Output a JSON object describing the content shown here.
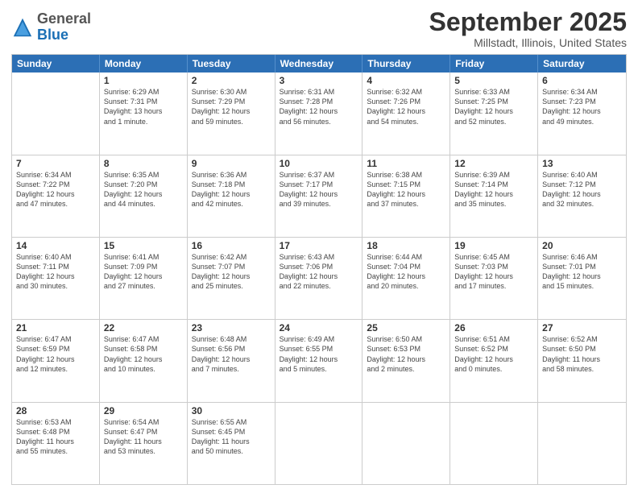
{
  "logo": {
    "general": "General",
    "blue": "Blue"
  },
  "title": "September 2025",
  "location": "Millstadt, Illinois, United States",
  "weekdays": [
    "Sunday",
    "Monday",
    "Tuesday",
    "Wednesday",
    "Thursday",
    "Friday",
    "Saturday"
  ],
  "rows": [
    [
      {
        "day": "",
        "info": ""
      },
      {
        "day": "1",
        "info": "Sunrise: 6:29 AM\nSunset: 7:31 PM\nDaylight: 13 hours\nand 1 minute."
      },
      {
        "day": "2",
        "info": "Sunrise: 6:30 AM\nSunset: 7:29 PM\nDaylight: 12 hours\nand 59 minutes."
      },
      {
        "day": "3",
        "info": "Sunrise: 6:31 AM\nSunset: 7:28 PM\nDaylight: 12 hours\nand 56 minutes."
      },
      {
        "day": "4",
        "info": "Sunrise: 6:32 AM\nSunset: 7:26 PM\nDaylight: 12 hours\nand 54 minutes."
      },
      {
        "day": "5",
        "info": "Sunrise: 6:33 AM\nSunset: 7:25 PM\nDaylight: 12 hours\nand 52 minutes."
      },
      {
        "day": "6",
        "info": "Sunrise: 6:34 AM\nSunset: 7:23 PM\nDaylight: 12 hours\nand 49 minutes."
      }
    ],
    [
      {
        "day": "7",
        "info": "Sunrise: 6:34 AM\nSunset: 7:22 PM\nDaylight: 12 hours\nand 47 minutes."
      },
      {
        "day": "8",
        "info": "Sunrise: 6:35 AM\nSunset: 7:20 PM\nDaylight: 12 hours\nand 44 minutes."
      },
      {
        "day": "9",
        "info": "Sunrise: 6:36 AM\nSunset: 7:18 PM\nDaylight: 12 hours\nand 42 minutes."
      },
      {
        "day": "10",
        "info": "Sunrise: 6:37 AM\nSunset: 7:17 PM\nDaylight: 12 hours\nand 39 minutes."
      },
      {
        "day": "11",
        "info": "Sunrise: 6:38 AM\nSunset: 7:15 PM\nDaylight: 12 hours\nand 37 minutes."
      },
      {
        "day": "12",
        "info": "Sunrise: 6:39 AM\nSunset: 7:14 PM\nDaylight: 12 hours\nand 35 minutes."
      },
      {
        "day": "13",
        "info": "Sunrise: 6:40 AM\nSunset: 7:12 PM\nDaylight: 12 hours\nand 32 minutes."
      }
    ],
    [
      {
        "day": "14",
        "info": "Sunrise: 6:40 AM\nSunset: 7:11 PM\nDaylight: 12 hours\nand 30 minutes."
      },
      {
        "day": "15",
        "info": "Sunrise: 6:41 AM\nSunset: 7:09 PM\nDaylight: 12 hours\nand 27 minutes."
      },
      {
        "day": "16",
        "info": "Sunrise: 6:42 AM\nSunset: 7:07 PM\nDaylight: 12 hours\nand 25 minutes."
      },
      {
        "day": "17",
        "info": "Sunrise: 6:43 AM\nSunset: 7:06 PM\nDaylight: 12 hours\nand 22 minutes."
      },
      {
        "day": "18",
        "info": "Sunrise: 6:44 AM\nSunset: 7:04 PM\nDaylight: 12 hours\nand 20 minutes."
      },
      {
        "day": "19",
        "info": "Sunrise: 6:45 AM\nSunset: 7:03 PM\nDaylight: 12 hours\nand 17 minutes."
      },
      {
        "day": "20",
        "info": "Sunrise: 6:46 AM\nSunset: 7:01 PM\nDaylight: 12 hours\nand 15 minutes."
      }
    ],
    [
      {
        "day": "21",
        "info": "Sunrise: 6:47 AM\nSunset: 6:59 PM\nDaylight: 12 hours\nand 12 minutes."
      },
      {
        "day": "22",
        "info": "Sunrise: 6:47 AM\nSunset: 6:58 PM\nDaylight: 12 hours\nand 10 minutes."
      },
      {
        "day": "23",
        "info": "Sunrise: 6:48 AM\nSunset: 6:56 PM\nDaylight: 12 hours\nand 7 minutes."
      },
      {
        "day": "24",
        "info": "Sunrise: 6:49 AM\nSunset: 6:55 PM\nDaylight: 12 hours\nand 5 minutes."
      },
      {
        "day": "25",
        "info": "Sunrise: 6:50 AM\nSunset: 6:53 PM\nDaylight: 12 hours\nand 2 minutes."
      },
      {
        "day": "26",
        "info": "Sunrise: 6:51 AM\nSunset: 6:52 PM\nDaylight: 12 hours\nand 0 minutes."
      },
      {
        "day": "27",
        "info": "Sunrise: 6:52 AM\nSunset: 6:50 PM\nDaylight: 11 hours\nand 58 minutes."
      }
    ],
    [
      {
        "day": "28",
        "info": "Sunrise: 6:53 AM\nSunset: 6:48 PM\nDaylight: 11 hours\nand 55 minutes."
      },
      {
        "day": "29",
        "info": "Sunrise: 6:54 AM\nSunset: 6:47 PM\nDaylight: 11 hours\nand 53 minutes."
      },
      {
        "day": "30",
        "info": "Sunrise: 6:55 AM\nSunset: 6:45 PM\nDaylight: 11 hours\nand 50 minutes."
      },
      {
        "day": "",
        "info": ""
      },
      {
        "day": "",
        "info": ""
      },
      {
        "day": "",
        "info": ""
      },
      {
        "day": "",
        "info": ""
      }
    ]
  ]
}
